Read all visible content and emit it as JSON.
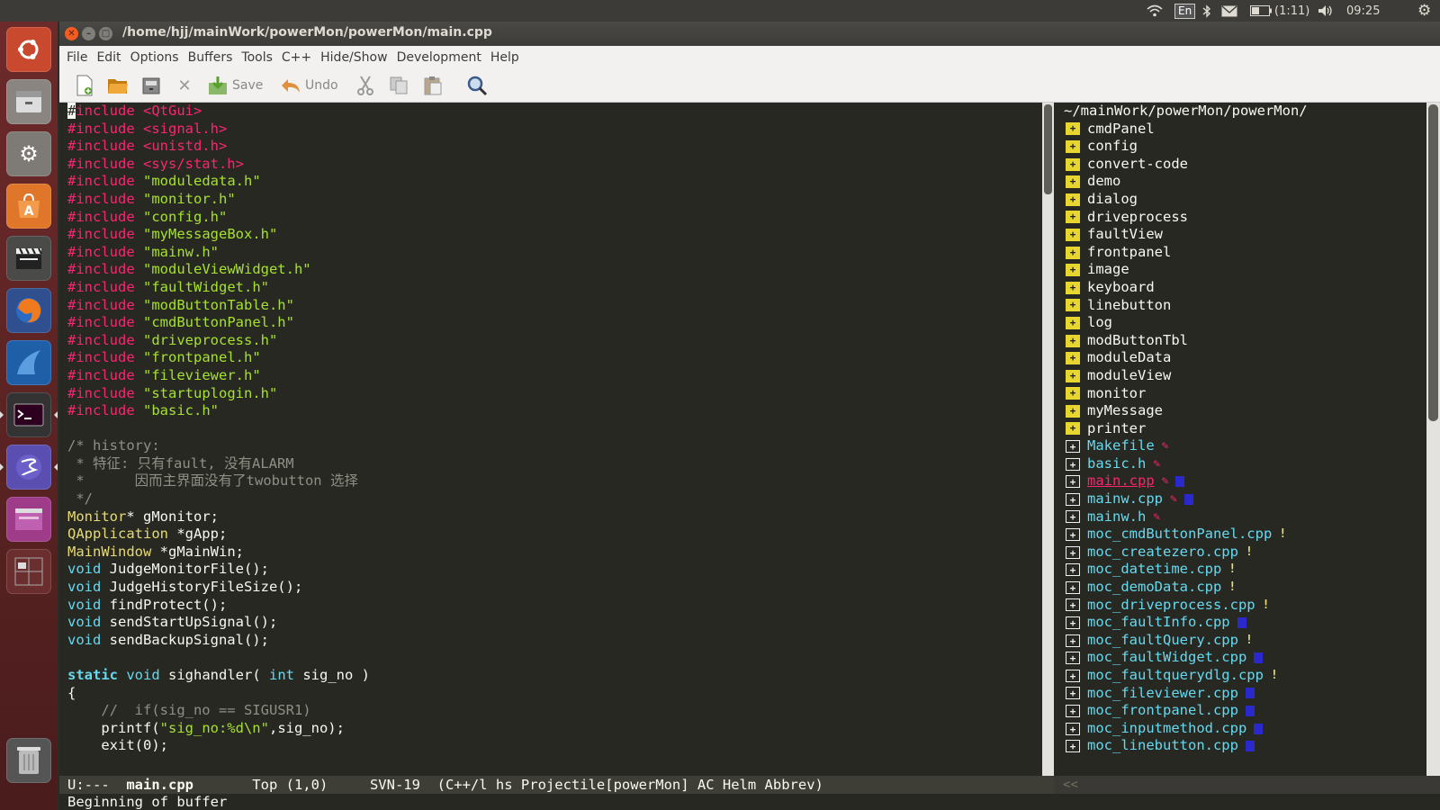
{
  "topbar": {
    "lang": "En",
    "battery": "(1:11)",
    "clock": "09:25",
    "icons": [
      "wifi-icon",
      "bluetooth-icon",
      "mail-icon",
      "battery-icon",
      "volume-icon",
      "settings-gear-icon"
    ]
  },
  "launcher": {
    "items": [
      "ubuntu-dash-icon",
      "files-icon",
      "system-settings-icon",
      "software-center-icon",
      "video-editor-icon",
      "firefox-icon",
      "wireshark-icon",
      "terminal-icon",
      "emacs-icon",
      "workspace-switcher-icon",
      "desktop-icon",
      "trash-icon"
    ]
  },
  "window": {
    "title": "/home/hjj/mainWork/powerMon/powerMon/main.cpp"
  },
  "menubar": {
    "items": [
      "File",
      "Edit",
      "Options",
      "Buffers",
      "Tools",
      "C++",
      "Hide/Show",
      "Development",
      "Help"
    ]
  },
  "toolbar": {
    "save_label": "Save",
    "undo_label": "Undo"
  },
  "editor": {
    "lines": [
      {
        "t": "pre",
        "text": "#include <QtGui>"
      },
      {
        "t": "pre",
        "text": "#include <signal.h>"
      },
      {
        "t": "pre",
        "text": "#include <unistd.h>"
      },
      {
        "t": "pre",
        "text": "#include <sys/stat.h>"
      },
      {
        "t": "inc",
        "kw": "#include ",
        "str": "\"moduledata.h\""
      },
      {
        "t": "inc",
        "kw": "#include ",
        "str": "\"monitor.h\""
      },
      {
        "t": "inc",
        "kw": "#include ",
        "str": "\"config.h\""
      },
      {
        "t": "inc",
        "kw": "#include ",
        "str": "\"myMessageBox.h\""
      },
      {
        "t": "inc",
        "kw": "#include ",
        "str": "\"mainw.h\""
      },
      {
        "t": "inc",
        "kw": "#include ",
        "str": "\"moduleViewWidget.h\""
      },
      {
        "t": "inc",
        "kw": "#include ",
        "str": "\"faultWidget.h\""
      },
      {
        "t": "inc",
        "kw": "#include ",
        "str": "\"modButtonTable.h\""
      },
      {
        "t": "inc",
        "kw": "#include ",
        "str": "\"cmdButtonPanel.h\""
      },
      {
        "t": "inc",
        "kw": "#include ",
        "str": "\"driveprocess.h\""
      },
      {
        "t": "inc",
        "kw": "#include ",
        "str": "\"frontpanel.h\""
      },
      {
        "t": "inc",
        "kw": "#include ",
        "str": "\"fileviewer.h\""
      },
      {
        "t": "inc",
        "kw": "#include ",
        "str": "\"startuplogin.h\""
      },
      {
        "t": "inc",
        "kw": "#include ",
        "str": "\"basic.h\""
      },
      {
        "t": "plain",
        "text": ""
      },
      {
        "t": "cmt",
        "text": "/* history:"
      },
      {
        "t": "cmt",
        "text": " * 特征: 只有fault, 没有ALARM"
      },
      {
        "t": "cmt",
        "text": " *      因而主界面没有了twobutton 选择"
      },
      {
        "t": "cmt",
        "text": " */"
      },
      {
        "t": "decl",
        "type": "Monitor",
        "rest": "* gMonitor;"
      },
      {
        "t": "decl",
        "type": "QApplication",
        "rest": " *gApp;"
      },
      {
        "t": "decl",
        "type": "MainWindow",
        "rest": " *gMainWin;"
      },
      {
        "t": "decl",
        "type": "void",
        "rest": " JudgeMonitorFile();"
      },
      {
        "t": "decl",
        "type": "void",
        "rest": " JudgeHistoryFileSize();"
      },
      {
        "t": "decl",
        "type": "void",
        "rest": " findProtect();"
      },
      {
        "t": "decl",
        "type": "void",
        "rest": " sendStartUpSignal();"
      },
      {
        "t": "decl",
        "type": "void",
        "rest": " sendBackupSignal();"
      },
      {
        "t": "plain",
        "text": ""
      },
      {
        "t": "sig",
        "kw": "static",
        "kw2": " void",
        "mid": " sighandler( ",
        "kw3": "int",
        "end": " sig_no )"
      },
      {
        "t": "plain",
        "text": "{"
      },
      {
        "t": "cmt",
        "text": "    //  if(sig_no == SIGUSR1)"
      },
      {
        "t": "printf",
        "pre": "    printf(",
        "str": "\"sig_no:%d\\n\"",
        "post": ",sig_no);"
      },
      {
        "t": "plain",
        "text": "    exit(0);"
      }
    ]
  },
  "tree": {
    "header": "~/mainWork/powerMon/powerMon/",
    "items": [
      {
        "name": "cmdPanel",
        "kind": "dir"
      },
      {
        "name": "config",
        "kind": "dir"
      },
      {
        "name": "convert-code",
        "kind": "dir"
      },
      {
        "name": "demo",
        "kind": "dir"
      },
      {
        "name": "dialog",
        "kind": "dir"
      },
      {
        "name": "driveprocess",
        "kind": "dir"
      },
      {
        "name": "faultView",
        "kind": "dir"
      },
      {
        "name": "frontpanel",
        "kind": "dir"
      },
      {
        "name": "image",
        "kind": "dir"
      },
      {
        "name": "keyboard",
        "kind": "dir"
      },
      {
        "name": "linebutton",
        "kind": "dir"
      },
      {
        "name": "log",
        "kind": "dir"
      },
      {
        "name": "modButtonTbl",
        "kind": "dir"
      },
      {
        "name": "moduleData",
        "kind": "dir"
      },
      {
        "name": "moduleView",
        "kind": "dir"
      },
      {
        "name": "monitor",
        "kind": "dir"
      },
      {
        "name": "myMessage",
        "kind": "dir"
      },
      {
        "name": "printer",
        "kind": "dir"
      },
      {
        "name": "Makefile",
        "kind": "file",
        "vc": "edited"
      },
      {
        "name": "basic.h",
        "kind": "file",
        "vc": "edited"
      },
      {
        "name": "main.cpp",
        "kind": "file",
        "vc": "edited-sq",
        "current": true
      },
      {
        "name": "mainw.cpp",
        "kind": "file",
        "vc": "edited-sq"
      },
      {
        "name": "mainw.h",
        "kind": "file",
        "vc": "edited"
      },
      {
        "name": "moc_cmdButtonPanel.cpp",
        "kind": "file",
        "vc": "warn"
      },
      {
        "name": "moc_createzero.cpp",
        "kind": "file",
        "vc": "warn"
      },
      {
        "name": "moc_datetime.cpp",
        "kind": "file",
        "vc": "warn"
      },
      {
        "name": "moc_demoData.cpp",
        "kind": "file",
        "vc": "warn"
      },
      {
        "name": "moc_driveprocess.cpp",
        "kind": "file",
        "vc": "warn"
      },
      {
        "name": "moc_faultInfo.cpp",
        "kind": "file",
        "vc": "sq"
      },
      {
        "name": "moc_faultQuery.cpp",
        "kind": "file",
        "vc": "warn"
      },
      {
        "name": "moc_faultWidget.cpp",
        "kind": "file",
        "vc": "sq"
      },
      {
        "name": "moc_faultquerydlg.cpp",
        "kind": "file",
        "vc": "warn"
      },
      {
        "name": "moc_fileviewer.cpp",
        "kind": "file",
        "vc": "sq"
      },
      {
        "name": "moc_frontpanel.cpp",
        "kind": "file",
        "vc": "sq"
      },
      {
        "name": "moc_inputmethod.cpp",
        "kind": "file",
        "vc": "sq"
      },
      {
        "name": "moc_linebutton.cpp",
        "kind": "file",
        "vc": "sq"
      }
    ]
  },
  "modeline": {
    "status": "U:---  ",
    "buffer": "main.cpp",
    "position": "       Top (1,0)     ",
    "rest": "SVN-19  (C++/l hs Projectile[powerMon] AC Helm Abbrev)",
    "right": "<<"
  },
  "minibuffer": {
    "message": "Beginning of buffer"
  },
  "colors": {
    "editor_bg": "#272822",
    "preprocessor": "#f92672",
    "string": "#a6e22e",
    "comment": "#8f8f85",
    "type": "#e6db74",
    "keyword": "#66d9ef",
    "launcher": "#5a2222"
  }
}
